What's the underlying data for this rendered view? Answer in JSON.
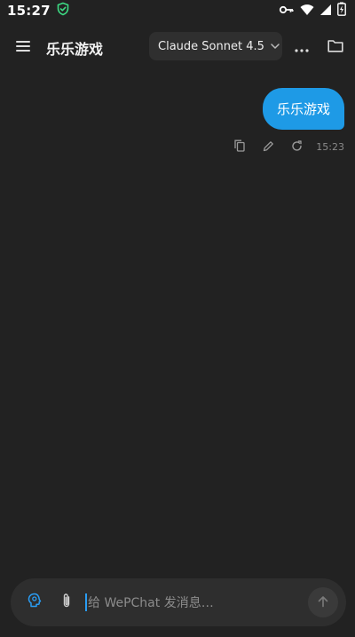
{
  "status_bar": {
    "time": "15:27",
    "icons": [
      "shield-check-icon",
      "key-icon",
      "wifi-icon",
      "signal-icon",
      "battery-charging-icon"
    ]
  },
  "app_bar": {
    "title": "乐乐游戏",
    "model": "Claude Sonnet 4.5",
    "icons": [
      "menu-icon",
      "chevron-down-icon",
      "more-horizontal-icon",
      "folder-icon"
    ]
  },
  "messages": [
    {
      "role": "user",
      "text": "乐乐游戏",
      "time": "15:23",
      "actions": [
        "copy-icon",
        "edit-icon",
        "refresh-icon"
      ]
    }
  ],
  "composer": {
    "placeholder": "给 WePChat 发消息…",
    "icons": [
      "brain-icon",
      "paperclip-icon",
      "arrow-up-icon"
    ]
  },
  "colors": {
    "background": "#222222",
    "bubble": "#1e9ae6",
    "accent": "#2a9df4",
    "surface": "#2e2e2e"
  }
}
